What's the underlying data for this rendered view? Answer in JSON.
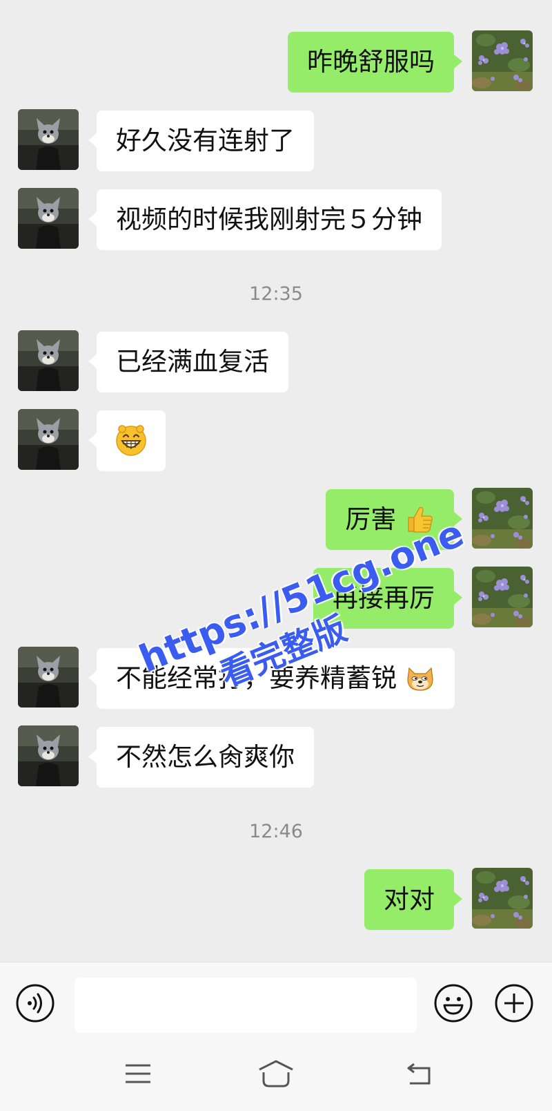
{
  "conversation": {
    "messages": [
      {
        "side": "right",
        "text": "昨晚舒服吗"
      },
      {
        "side": "left",
        "text": "好久没有连射了"
      },
      {
        "side": "left",
        "text": "视频的时候我刚射完５分钟"
      },
      {
        "side": "left",
        "text": "已经满血复活"
      },
      {
        "side": "left",
        "emoji": "grinning-face"
      },
      {
        "side": "right",
        "text": "厉害",
        "emoji": "thumbs-up"
      },
      {
        "side": "right",
        "text": "再接再厉"
      },
      {
        "side": "left",
        "text": "不能经常打，要养精蓄锐",
        "emoji": "doge"
      },
      {
        "side": "left",
        "text": "不然怎么肏爽你"
      },
      {
        "side": "right",
        "text": "对对"
      }
    ],
    "timestamps": [
      "12:35",
      "12:46"
    ]
  },
  "watermark": {
    "line1": "https://51cg.one",
    "line2": "看完整版",
    "color": "#3a5cf0"
  },
  "input_bar": {
    "voice_icon": "voice-icon",
    "emoji_icon": "smiley-icon",
    "plus_icon": "plus-icon",
    "input_value": ""
  },
  "nav": {
    "menu_icon": "menu-icon",
    "home_icon": "home-icon",
    "back_icon": "back-icon"
  },
  "colors": {
    "background": "#ededed",
    "sent_bubble": "#95ec69",
    "received_bubble": "#ffffff",
    "timestamp": "#8a8a8a"
  }
}
